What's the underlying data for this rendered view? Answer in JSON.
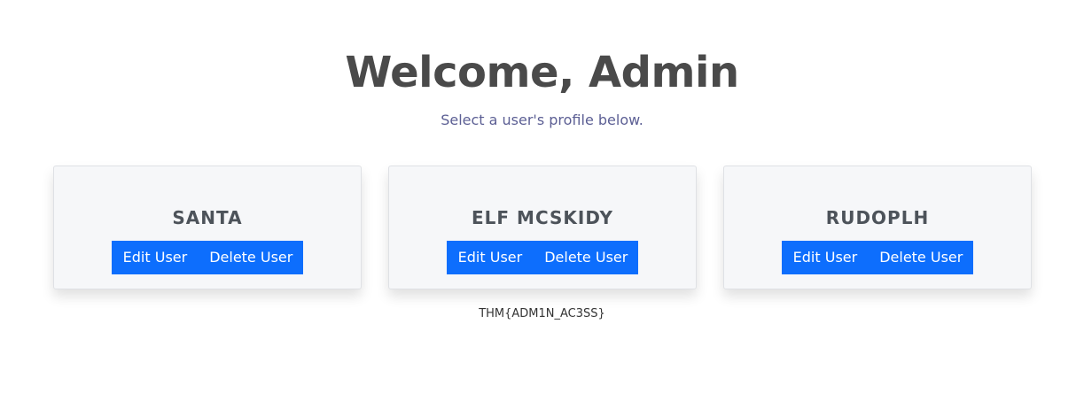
{
  "header": {
    "title": "Welcome, Admin",
    "subtitle": "Select a user's profile below."
  },
  "users": [
    {
      "name": "SANTA",
      "edit_label": "Edit User",
      "delete_label": "Delete User"
    },
    {
      "name": "ELF MCSKIDY",
      "edit_label": "Edit User",
      "delete_label": "Delete User"
    },
    {
      "name": "RUDOPLH",
      "edit_label": "Edit User",
      "delete_label": "Delete User"
    }
  ],
  "flag": "THM{ADM1N_AC3SS}",
  "colors": {
    "accent": "#0d6efd",
    "title": "#4a4a4a",
    "subtitle": "#5c5f94",
    "card_background": "#f6f7f9"
  }
}
